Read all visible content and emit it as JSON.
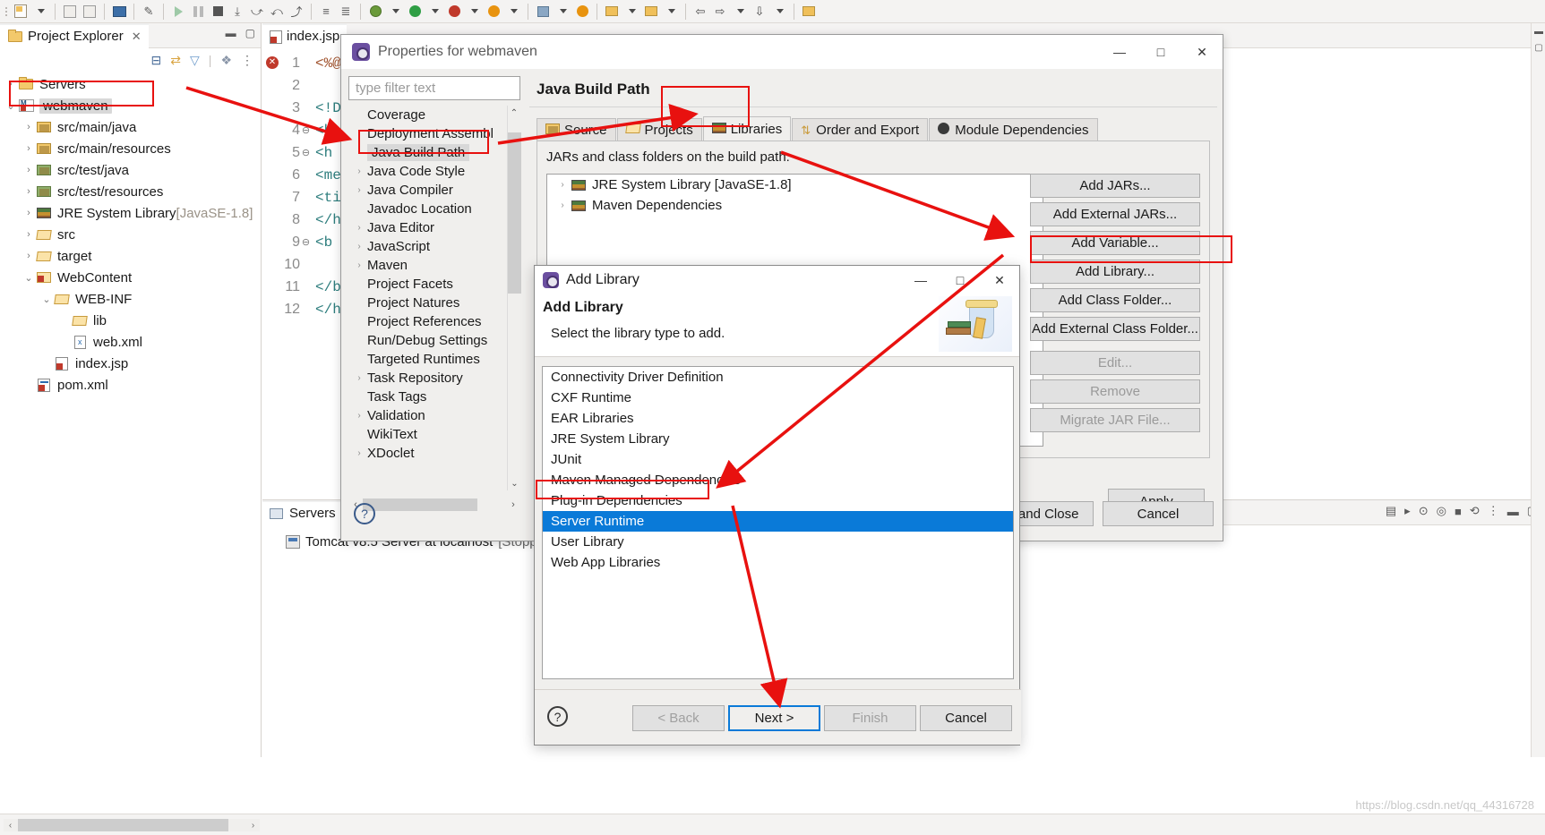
{
  "toolbar": {
    "icons": [
      "new-wizard-icon",
      "dropdown-caret-icon",
      "save-icon",
      "save-all-icon",
      "print-icon",
      "toggle-marker-icon",
      "run-last-icon",
      "step-over-icon",
      "terminate-icon",
      "skip-breakpoints-icon",
      "step-into-icon",
      "step-return-icon",
      "drop-to-frame-icon",
      "next-annotation-icon",
      "previous-annotation-icon",
      "debug-icon",
      "run-icon",
      "coverage-icon",
      "search-icon",
      "open-perspective-icon",
      "open-type-icon",
      "new-folder-icon",
      "external-tools-icon",
      "back-icon",
      "forward-icon",
      "pin-icon",
      "new-java-project-icon"
    ]
  },
  "project_explorer": {
    "tab_label": "Project Explorer",
    "close_glyph": "✕",
    "toolbar_icons": [
      "collapse-all-icon",
      "link-with-editor-icon",
      "view-menu-filter-icon",
      "working-sets-icon",
      "view-menu-icon"
    ],
    "tree": [
      {
        "indent": 0,
        "arrow": "›",
        "icon": "folder-icon",
        "label": "Servers",
        "dim": ""
      },
      {
        "indent": 0,
        "arrow": "⌄",
        "icon": "maven-project-icon",
        "label": "webmaven",
        "selected": true
      },
      {
        "indent": 1,
        "arrow": "›",
        "icon": "source-package-icon",
        "label": "src/main/java"
      },
      {
        "indent": 1,
        "arrow": "›",
        "icon": "source-package-icon",
        "label": "src/main/resources"
      },
      {
        "indent": 1,
        "arrow": "›",
        "icon": "test-package-icon",
        "label": "src/test/java"
      },
      {
        "indent": 1,
        "arrow": "›",
        "icon": "test-package-icon",
        "label": "src/test/resources"
      },
      {
        "indent": 1,
        "arrow": "›",
        "icon": "library-icon",
        "label": "JRE System Library",
        "dim": "[JavaSE-1.8]"
      },
      {
        "indent": 1,
        "arrow": "›",
        "icon": "folder-open-icon",
        "label": "src"
      },
      {
        "indent": 1,
        "arrow": "›",
        "icon": "folder-open-icon",
        "label": "target"
      },
      {
        "indent": 1,
        "arrow": "⌄",
        "icon": "web-folder-icon",
        "label": "WebContent"
      },
      {
        "indent": 2,
        "arrow": "⌄",
        "icon": "folder-open-icon",
        "label": "WEB-INF"
      },
      {
        "indent": 3,
        "arrow": "",
        "icon": "folder-open-icon",
        "label": "lib"
      },
      {
        "indent": 3,
        "arrow": "",
        "icon": "xml-file-icon",
        "label": "web.xml"
      },
      {
        "indent": 2,
        "arrow": "",
        "icon": "jsp-file-icon",
        "label": "index.jsp"
      },
      {
        "indent": 1,
        "arrow": "",
        "icon": "pom-file-icon",
        "label": "pom.xml"
      }
    ]
  },
  "editor": {
    "tab_label": "index.jsp",
    "lines": [
      {
        "num": "1",
        "fold": "",
        "text": "<%@",
        "kind": "jsp",
        "error": true
      },
      {
        "num": "2",
        "fold": "",
        "text": "",
        "kind": ""
      },
      {
        "num": "3",
        "fold": "",
        "text": "<!D",
        "kind": ""
      },
      {
        "num": "4",
        "fold": "⊖",
        "text": "<h",
        "kind": ""
      },
      {
        "num": "5",
        "fold": "⊖",
        "text": "<h",
        "kind": ""
      },
      {
        "num": "6",
        "fold": "",
        "text": "<me",
        "kind": ""
      },
      {
        "num": "7",
        "fold": "",
        "text": "<ti",
        "kind": ""
      },
      {
        "num": "8",
        "fold": "",
        "text": "</h",
        "kind": ""
      },
      {
        "num": "9",
        "fold": "⊖",
        "text": "<b",
        "kind": ""
      },
      {
        "num": "10",
        "fold": "",
        "text": "",
        "kind": ""
      },
      {
        "num": "11",
        "fold": "",
        "text": "</b",
        "kind": ""
      },
      {
        "num": "12",
        "fold": "",
        "text": "</h",
        "kind": ""
      }
    ]
  },
  "servers_view": {
    "tab_label": "Servers",
    "close_glyph": "✕",
    "row_label": "Tomcat v8.5 Server at localhost",
    "row_status": "[Stopp",
    "toolbar_icons": [
      "start-icon",
      "debug-icon",
      "stop-icon",
      "publish-icon",
      "view-menu-icon",
      "minimize-icon",
      "maximize-icon"
    ]
  },
  "properties_dialog": {
    "title": "Properties for webmaven",
    "window_buttons": [
      "minimize",
      "maximize",
      "close"
    ],
    "minimize_glyph": "—",
    "maximize_glyph": "□",
    "close_glyph": "✕",
    "filter_placeholder": "type filter text",
    "tree": [
      {
        "arrow": "",
        "label": "Coverage"
      },
      {
        "arrow": "",
        "label": "Deployment Assembl"
      },
      {
        "arrow": "",
        "label": "Java Build Path",
        "selected": true
      },
      {
        "arrow": "›",
        "label": "Java Code Style"
      },
      {
        "arrow": "›",
        "label": "Java Compiler"
      },
      {
        "arrow": "",
        "label": "Javadoc Location"
      },
      {
        "arrow": "›",
        "label": "Java Editor"
      },
      {
        "arrow": "›",
        "label": "JavaScript"
      },
      {
        "arrow": "›",
        "label": "Maven"
      },
      {
        "arrow": "",
        "label": "Project Facets"
      },
      {
        "arrow": "",
        "label": "Project Natures"
      },
      {
        "arrow": "",
        "label": "Project References"
      },
      {
        "arrow": "",
        "label": "Run/Debug Settings"
      },
      {
        "arrow": "",
        "label": "Targeted Runtimes"
      },
      {
        "arrow": "›",
        "label": "Task Repository"
      },
      {
        "arrow": "",
        "label": "Task Tags"
      },
      {
        "arrow": "›",
        "label": "Validation"
      },
      {
        "arrow": "",
        "label": "WikiText"
      },
      {
        "arrow": "›",
        "label": "XDoclet"
      }
    ],
    "page_title": "Java Build Path",
    "tabs": [
      {
        "label": "Source",
        "icon": "source-folder-icon",
        "active": false
      },
      {
        "label": "Projects",
        "icon": "projects-icon",
        "active": false
      },
      {
        "label": "Libraries",
        "icon": "libraries-icon",
        "active": true
      },
      {
        "label": "Order and Export",
        "icon": "order-export-icon",
        "active": false
      },
      {
        "label": "Module Dependencies",
        "icon": "module-dependencies-icon",
        "active": false
      }
    ],
    "content_label": "JARs and class folders on the build path:",
    "entries": [
      {
        "arrow": "›",
        "icon": "library-icon",
        "label": "JRE System Library [JavaSE-1.8]"
      },
      {
        "arrow": "›",
        "icon": "library-icon",
        "label": "Maven Dependencies"
      }
    ],
    "buttons": [
      {
        "label": "Add JARs...",
        "disabled": false
      },
      {
        "label": "Add External JARs...",
        "disabled": false
      },
      {
        "label": "Add Variable...",
        "disabled": false
      },
      {
        "label": "Add Library...",
        "disabled": false,
        "highlighted": true
      },
      {
        "label": "Add Class Folder...",
        "disabled": false
      },
      {
        "label": "Add External Class Folder...",
        "disabled": false
      },
      {
        "label": "Edit...",
        "disabled": true
      },
      {
        "label": "Remove",
        "disabled": true
      },
      {
        "label": "Migrate JAR File...",
        "disabled": true
      }
    ],
    "apply_label": "Apply",
    "apply_close_label": "ply and Close",
    "cancel_label": "Cancel",
    "help_glyph": "?"
  },
  "add_library_dialog": {
    "title": "Add Library",
    "heading": "Add Library",
    "subheading": "Select the library type to add.",
    "minimize_glyph": "—",
    "maximize_glyph": "□",
    "close_glyph": "✕",
    "items": [
      {
        "label": "Connectivity Driver Definition",
        "selected": false
      },
      {
        "label": "CXF Runtime",
        "selected": false
      },
      {
        "label": "EAR Libraries",
        "selected": false
      },
      {
        "label": "JRE System Library",
        "selected": false
      },
      {
        "label": "JUnit",
        "selected": false
      },
      {
        "label": "Maven Managed Dependencies",
        "selected": false
      },
      {
        "label": "Plug-in Dependencies",
        "selected": false
      },
      {
        "label": "Server Runtime",
        "selected": true
      },
      {
        "label": "User Library",
        "selected": false
      },
      {
        "label": "Web App Libraries",
        "selected": false
      }
    ],
    "buttons": [
      {
        "label": "< Back",
        "state": "disabled"
      },
      {
        "label": "Next >",
        "state": "default"
      },
      {
        "label": "Finish",
        "state": "disabled"
      },
      {
        "label": "Cancel",
        "state": "normal"
      }
    ],
    "help_glyph": "?"
  },
  "watermark": "https://blog.csdn.net/qq_44316728",
  "annotation_color": "#e8110f"
}
